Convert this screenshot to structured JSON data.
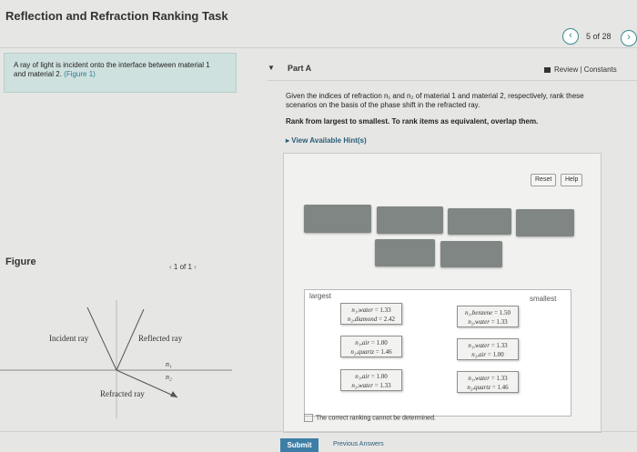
{
  "header": {
    "title": "Reflection and Refraction Ranking Task",
    "count": "5 of 28",
    "prev_icon": "chevron-left-icon",
    "next_icon": "chevron-right-icon"
  },
  "intro": {
    "text": "A ray of light is incident onto the interface between material 1 and material 2.",
    "figure_link": "(Figure 1)"
  },
  "part": {
    "label": "Part A",
    "review_link": "Review | Constants",
    "question_line1": "Given the indices of refraction n₁ and n₂ of material 1 and material 2, respectively, rank these",
    "question_line2": "scenarios on the basis of the phase shift in the refracted ray.",
    "instruction": "Rank from largest to smallest. To rank items as equivalent, overlap them.",
    "hints": "View Available Hint(s)"
  },
  "panel": {
    "reset_label": "Reset",
    "help_label": "Help",
    "largest_label": "largest",
    "smallest_label": "smallest",
    "no_correct_label": "The correct ranking cannot be determined."
  },
  "cards": [
    {
      "n1_label": "n₁,water",
      "n1": "1.33",
      "n2_label": "n₂,diamond",
      "n2": "2.42"
    },
    {
      "n1_label": "n₁,benzene",
      "n1": "1.50",
      "n2_label": "n₂,water",
      "n2": "1.33"
    },
    {
      "n1_label": "n₁,air",
      "n1": "1.00",
      "n2_label": "n₂,quartz",
      "n2": "1.46"
    },
    {
      "n1_label": "n₁,water",
      "n1": "1.33",
      "n2_label": "n₂,air",
      "n2": "1.00"
    },
    {
      "n1_label": "n₁,air",
      "n1": "1.00",
      "n2_label": "n₂,water",
      "n2": "1.33"
    },
    {
      "n1_label": "n₁,water",
      "n1": "1.33",
      "n2_label": "n₂,quartz",
      "n2": "1.46"
    }
  ],
  "figure": {
    "label": "Figure",
    "nav": "1 of 1",
    "incident": "Incident ray",
    "reflected": "Reflected ray",
    "refracted": "Refracted ray",
    "n1": "n₁",
    "n2": "n₂"
  },
  "footer": {
    "submit": "Submit",
    "previous": "Previous Answers"
  }
}
